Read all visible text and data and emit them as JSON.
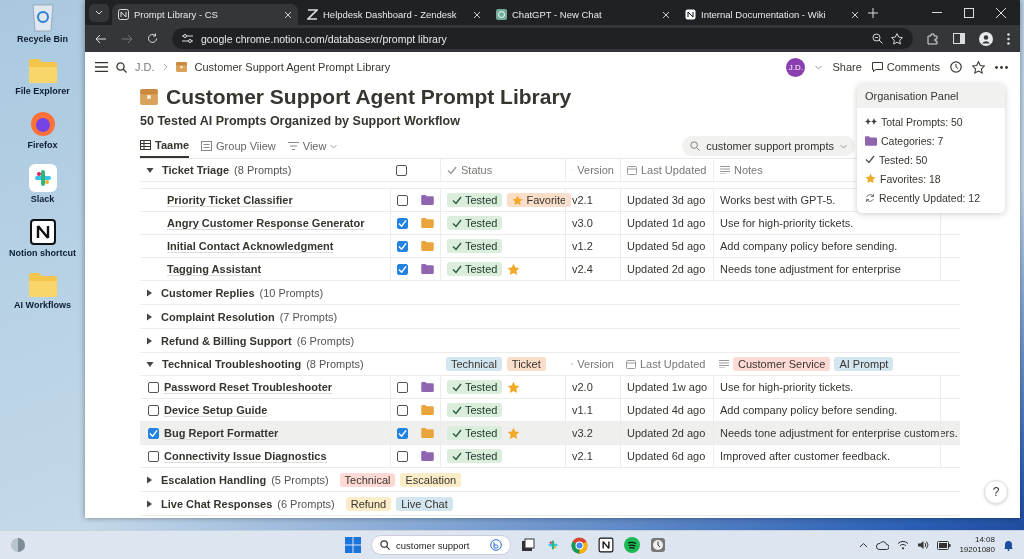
{
  "desktop_icons": [
    {
      "kind": "bin",
      "label": "Recycle Bin"
    },
    {
      "kind": "folder",
      "label": "File Explorer"
    },
    {
      "kind": "firefox",
      "label": "Firefox"
    },
    {
      "kind": "slack",
      "label": "Slack"
    },
    {
      "kind": "notion",
      "label": "Notion shortcut"
    },
    {
      "kind": "folder",
      "label": "AI Workflows"
    }
  ],
  "browser": {
    "tabs": [
      {
        "label": "Prompt Library - CS",
        "selected": true
      },
      {
        "label": "Helpdesk Dashboard - Zendesk",
        "selected": false
      },
      {
        "label": "ChatGPT - New Chat",
        "selected": false
      },
      {
        "label": "Internal Documentation - Wiki",
        "selected": false
      }
    ],
    "url": "google chrome.notion.com/databasexr/prompt library"
  },
  "topbar": {
    "workspace": "J.D.",
    "page": "Customer Support Agent Prompt Library",
    "avatar": "J.D.",
    "share": "Share",
    "comments": "Comments"
  },
  "title": "Customer Support Agent Prompt Library",
  "subtitle": "50 Tested AI Prompts Organized by Support Workflow",
  "views": [
    {
      "label": "Taame",
      "kind": "table",
      "selected": true
    },
    {
      "label": "Group Viiew",
      "kind": "list",
      "selected": false
    },
    {
      "label": "View",
      "kind": "filter",
      "selected": false
    }
  ],
  "search": {
    "value": "customer support prompts"
  },
  "groups": [
    {
      "title": "Ticket Triage",
      "count": "(8 Prompts)",
      "expanded": true,
      "header": {
        "kind": "columns",
        "checked": false,
        "status": "Status",
        "version": "Version",
        "updated": "Last Updated",
        "notes": "Notes"
      },
      "rows": [
        {
          "name": "Priority Ticket Classifier",
          "checked": false,
          "color": "#9065b0",
          "status": "Tested",
          "favorite": true,
          "favorite_label": "Favorite",
          "version": "v2.1",
          "updated": "Updated 3d ago",
          "notes": "Works best with GPT-5."
        },
        {
          "name": "Angry Customer Response Generator",
          "checked": true,
          "color": "#e9a53b",
          "status": "Tested",
          "favorite": false,
          "version": "v3.0",
          "updated": "Updated 1d ago",
          "notes": "Use for high-priority tickets."
        },
        {
          "name": "Initial Contact Acknowledgment",
          "checked": true,
          "color": "#e9a53b",
          "status": "Tested",
          "favorite": false,
          "version": "v1.2",
          "updated": "Updated 5d ago",
          "notes": "Add company policy before sending."
        },
        {
          "name": "Tagging Assistant",
          "checked": true,
          "color": "#9065b0",
          "status": "Tested",
          "favorite": true,
          "version": "v2.4",
          "updated": "Updated 2d ago",
          "notes": "Needs tone adjustment for enterprise"
        }
      ]
    },
    {
      "title": "Customer Replies",
      "count": "(10 Prompts)",
      "expanded": false
    },
    {
      "title": "Complaint Resolution",
      "count": "(7 Prompts)",
      "expanded": false
    },
    {
      "title": "Refund & Billing Support",
      "count": "(6 Prompts)",
      "expanded": false
    },
    {
      "title": "Technical Troubleshooting",
      "count": "(8 Prompts)",
      "expanded": true,
      "header": {
        "kind": "tags",
        "tags": [
          {
            "label": "Technical",
            "color": "#d3e5ef"
          },
          {
            "label": "Ticket",
            "color": "#fadec9"
          }
        ],
        "version": "Version",
        "updated": "Last Updated",
        "note_tags": [
          {
            "label": "Customer Service",
            "color": "#ffd9d4"
          },
          {
            "label": "AI Prompt",
            "color": "#d3e5ef"
          }
        ]
      },
      "rows": [
        {
          "name": "Password Reset Troubleshooter",
          "selected": false,
          "checked": false,
          "color": "#9065b0",
          "status": "Tested",
          "favorite": true,
          "version": "v2.0",
          "updated": "Updated 1w ago",
          "notes": "Use for high-priority tickets."
        },
        {
          "name": "Device Setup Guide",
          "selected": false,
          "checked": false,
          "color": "#e9a53b",
          "status": "Tested",
          "favorite": false,
          "version": "v1.1",
          "updated": "Updated 4d ago",
          "notes": "Add company policy before sending."
        },
        {
          "name": "Bug Report Formatter",
          "selected": true,
          "checked": true,
          "color": "#e9a53b",
          "status": "Tested",
          "favorite": true,
          "version": "v3.2",
          "updated": "Updated 2d ago",
          "notes": "Needs tone adjustment for enterprise customers."
        },
        {
          "name": "Connectivity Issue Diagnostics",
          "selected": false,
          "checked": false,
          "color": "#9065b0",
          "status": "Tested",
          "favorite": false,
          "version": "v2.1",
          "updated": "Updated 6d ago",
          "notes": "Improved after customer feedback."
        }
      ]
    },
    {
      "title": "Escalation Handling",
      "count": "(5 Prompts)",
      "expanded": false,
      "tags": [
        {
          "label": "Technical",
          "color": "#ffd9d4"
        },
        {
          "label": "Escalation",
          "color": "#fdecc8"
        }
      ]
    },
    {
      "title": "Live Chat Responses",
      "count": "(6 Prompts)",
      "expanded": false,
      "tags": [
        {
          "label": "Refund",
          "color": "#fdecc8"
        },
        {
          "label": "Live Chat",
          "color": "#d3e5ef"
        }
      ]
    }
  ],
  "org_panel": {
    "title": "Organisation Panel",
    "items": [
      {
        "kind": "total",
        "label": "Total Prompts: 50"
      },
      {
        "kind": "categories",
        "label": "Categories: 7"
      },
      {
        "kind": "tested",
        "label": "Tested: 50"
      },
      {
        "kind": "favorites",
        "label": "Favorites: 18"
      },
      {
        "kind": "recent",
        "label": "Recently Updated: 12"
      }
    ]
  },
  "help": "?",
  "taskbar": {
    "search": "customer support",
    "time": "14:08",
    "date": "19201080"
  }
}
